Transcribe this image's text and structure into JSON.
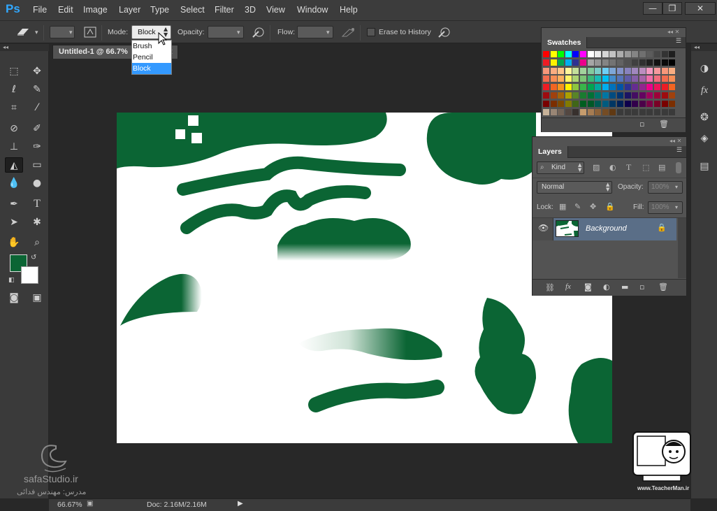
{
  "app": {
    "logo": "Ps"
  },
  "menu": [
    "File",
    "Edit",
    "Image",
    "Layer",
    "Type",
    "Select",
    "Filter",
    "3D",
    "View",
    "Window",
    "Help"
  ],
  "window_controls": {
    "minimize": "—",
    "restore": "❐",
    "close": "✕"
  },
  "options_bar": {
    "mode_label": "Mode:",
    "mode_value": "Block",
    "opacity_label": "Opacity:",
    "flow_label": "Flow:",
    "erase_to_history_label": "Erase to History"
  },
  "mode_dropdown": {
    "options": [
      "Brush",
      "Pencil",
      "Block"
    ],
    "selected": "Block"
  },
  "document_tab": {
    "title": "Untitled-1 @ 66.7%",
    "close": "✕"
  },
  "swatches_panel": {
    "title": "Swatches"
  },
  "layers_panel": {
    "title": "Layers",
    "kind_label": "Kind",
    "blend_mode": "Normal",
    "opacity_label": "Opacity:",
    "opacity_value": "100%",
    "lock_label": "Lock:",
    "fill_label": "Fill:",
    "fill_value": "100%",
    "layer_name": "Background"
  },
  "status_bar": {
    "zoom": "66.67%",
    "doc_info": "Doc: 2.16M/2.16M"
  },
  "watermarks": {
    "left_site": "safaStudio.ir",
    "left_caption": "مدرس: مهندس فدائی",
    "right_site": "www.TeacherMan.ir"
  },
  "colors": {
    "foreground": "#0b6534",
    "background": "#ffffff",
    "ui_dark": "#3b3b3b",
    "panel": "#535353",
    "accent_selection": "#3399ff",
    "layer_selected": "#5a6e87"
  },
  "icons": {
    "tools": [
      "marquee-icon",
      "move-icon",
      "lasso-icon",
      "quick-selection-icon",
      "crop-icon",
      "eyedropper-icon",
      "healing-brush-icon",
      "brush-icon",
      "clone-stamp-icon",
      "history-brush-icon",
      "eraser-icon",
      "gradient-icon",
      "blur-icon",
      "dodge-icon",
      "pen-icon",
      "type-icon",
      "path-selection-icon",
      "shape-icon",
      "hand-icon",
      "zoom-icon"
    ]
  }
}
